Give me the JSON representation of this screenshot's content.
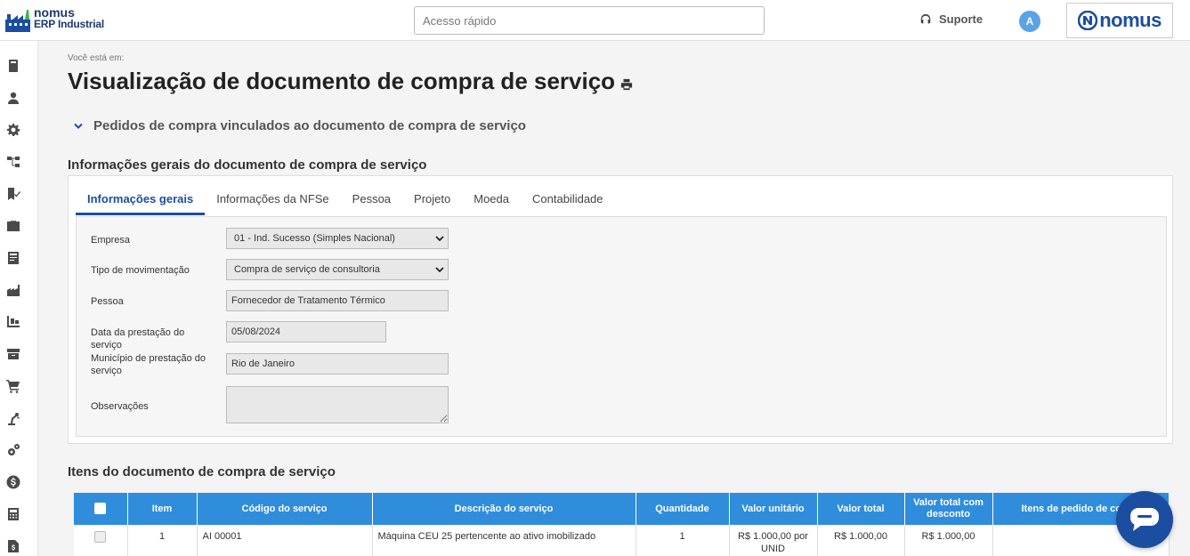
{
  "header": {
    "logo_line1": "nomus",
    "logo_line2": "ERP Industrial",
    "quick_access_placeholder": "Acesso rápido",
    "support_label": "Suporte",
    "avatar_initial": "A",
    "brand_name": "nomus",
    "brand_color": "#1b4ea0"
  },
  "sidebar": {
    "items": [
      {
        "icon": "book-icon"
      },
      {
        "icon": "user-icon"
      },
      {
        "icon": "gear-icon"
      },
      {
        "icon": "hierarchy-icon"
      },
      {
        "icon": "flag-check-icon"
      },
      {
        "icon": "briefcase-icon"
      },
      {
        "icon": "ledger-icon"
      },
      {
        "icon": "factory-icon"
      },
      {
        "icon": "dolly-icon"
      },
      {
        "icon": "archive-box-icon"
      },
      {
        "icon": "cart-icon"
      },
      {
        "icon": "robot-arm-icon"
      },
      {
        "icon": "gears-icon"
      },
      {
        "icon": "dollar-icon"
      },
      {
        "icon": "calculator-icon"
      },
      {
        "icon": "document-dollar-icon"
      }
    ]
  },
  "page": {
    "breadcrumb": "Você está em:",
    "title": "Visualização de documento de compra de serviço",
    "linked_orders_label": "Pedidos de compra vinculados ao documento de compra de serviço",
    "general_section_title": "Informações gerais do documento de compra de serviço",
    "items_section_title": "Itens do documento de compra de serviço"
  },
  "tabs": [
    {
      "label": "Informações gerais",
      "active": true
    },
    {
      "label": "Informações da NFSe",
      "active": false
    },
    {
      "label": "Pessoa",
      "active": false
    },
    {
      "label": "Projeto",
      "active": false
    },
    {
      "label": "Moeda",
      "active": false
    },
    {
      "label": "Contabilidade",
      "active": false
    }
  ],
  "form": {
    "empresa": {
      "label": "Empresa",
      "value": "01 - Ind. Sucesso (Simples Nacional)"
    },
    "tipo_movimentacao": {
      "label": "Tipo de movimentação",
      "value": "Compra de serviço de consultoria"
    },
    "pessoa": {
      "label": "Pessoa",
      "value": "Fornecedor de Tratamento Térmico"
    },
    "data_prestacao": {
      "label": "Data da prestação do serviço",
      "value": "05/08/2024"
    },
    "municipio": {
      "label": "Município de prestação do serviço",
      "value": "Rio de Janeiro"
    },
    "observacoes": {
      "label": "Observações",
      "value": ""
    }
  },
  "items_table": {
    "columns": [
      "Item",
      "Código do serviço",
      "Descrição do serviço",
      "Quantidade",
      "Valor unitário",
      "Valor total",
      "Valor total com desconto",
      "Itens de pedido de co"
    ],
    "rows": [
      {
        "item": "1",
        "codigo": "AI 00001",
        "descricao": "Máquina CEU 25 pertencente ao ativo imobilizado",
        "quantidade": "1",
        "valor_unitario": "R$ 1.000,00 por UNID",
        "valor_total": "R$ 1.000,00",
        "valor_total_desconto": "R$ 1.000,00",
        "itens_pedido": ""
      }
    ],
    "header_color": "#2f8ddc"
  }
}
